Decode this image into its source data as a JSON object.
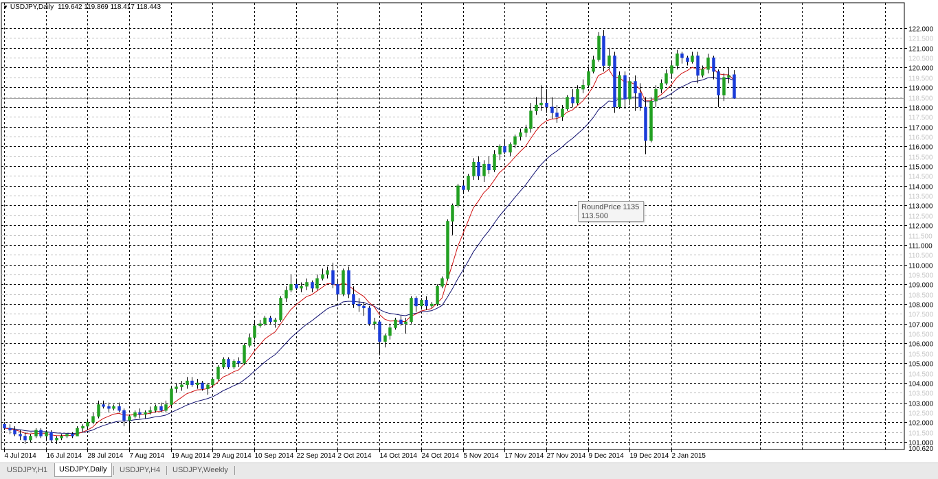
{
  "header": {
    "symbol_label": "USDJPY,Daily",
    "ohlc": "119.642 119.869 118.417 118.443"
  },
  "tooltip": {
    "line1": "RoundPrice 1135",
    "line2": "113.500"
  },
  "tabs": [
    {
      "label": "USDJPY,H1",
      "active": false
    },
    {
      "label": "USDJPY,Daily",
      "active": true
    },
    {
      "label": "USDJPY,H4",
      "active": false
    },
    {
      "label": "USDJPY,Weekly",
      "active": false
    }
  ],
  "colors": {
    "bull": "#22a022",
    "bear": "#1a3cd8",
    "ma_fast": "#d01010",
    "ma_slow": "#101070",
    "grid_major": "#000000",
    "grid_minor": "#b8b8b8"
  },
  "chart_data": {
    "type": "candlestick",
    "symbol": "USDJPY",
    "timeframe": "Daily",
    "y_range": [
      100.62,
      122.87
    ],
    "current_price": 118.443,
    "y_major_ticks": [
      "101.000",
      "102.000",
      "103.000",
      "104.000",
      "105.000",
      "106.000",
      "107.000",
      "108.000",
      "109.000",
      "110.000",
      "111.000",
      "112.000",
      "113.000",
      "114.000",
      "115.000",
      "116.000",
      "117.000",
      "118.000",
      "119.000",
      "120.000",
      "121.000",
      "122.000"
    ],
    "y_minor_ticks": [
      "101.500",
      "102.500",
      "103.500",
      "104.500",
      "105.500",
      "106.500",
      "107.500",
      "108.500",
      "109.500",
      "110.500",
      "111.500",
      "112.500",
      "113.500",
      "114.500",
      "115.500",
      "116.500",
      "117.500",
      "118.500",
      "119.500",
      "120.500",
      "121.500"
    ],
    "y_bottom_label": "100.620",
    "x_labels": [
      "4 Jul 2014",
      "16 Jul 2014",
      "28 Jul 2014",
      "7 Aug 2014",
      "19 Aug 2014",
      "29 Aug 2014",
      "10 Sep 2014",
      "22 Sep 2014",
      "2 Oct 2014",
      "14 Oct 2014",
      "24 Oct 2014",
      "5 Nov 2014",
      "17 Nov 2014",
      "27 Nov 2014",
      "9 Dec 2014",
      "19 Dec 2014",
      "2 Jan 2015"
    ],
    "series_ma": [
      "fast",
      "slow"
    ],
    "candles": [
      [
        101.9,
        102.0,
        101.6,
        101.7
      ],
      [
        101.7,
        101.9,
        101.4,
        101.6
      ],
      [
        101.6,
        101.8,
        101.3,
        101.4
      ],
      [
        101.4,
        101.6,
        101.1,
        101.3
      ],
      [
        101.3,
        101.5,
        100.9,
        101.1
      ],
      [
        101.1,
        101.4,
        101.0,
        101.3
      ],
      [
        101.3,
        101.7,
        101.2,
        101.6
      ],
      [
        101.6,
        101.7,
        101.2,
        101.3
      ],
      [
        101.3,
        101.6,
        101.1,
        101.5
      ],
      [
        101.5,
        101.6,
        101.0,
        101.1
      ],
      [
        101.1,
        101.3,
        100.9,
        101.2
      ],
      [
        101.2,
        101.4,
        101.1,
        101.3
      ],
      [
        101.3,
        101.4,
        101.2,
        101.4
      ],
      [
        101.4,
        101.5,
        101.2,
        101.3
      ],
      [
        101.3,
        101.8,
        101.3,
        101.7
      ],
      [
        101.7,
        101.9,
        101.5,
        101.8
      ],
      [
        101.8,
        102.1,
        101.6,
        102.0
      ],
      [
        102.0,
        102.5,
        101.9,
        102.3
      ],
      [
        102.3,
        103.1,
        102.2,
        102.9
      ],
      [
        102.9,
        103.1,
        102.7,
        102.8
      ],
      [
        102.8,
        103.0,
        102.5,
        102.7
      ],
      [
        102.7,
        102.9,
        102.6,
        102.8
      ],
      [
        102.8,
        103.0,
        102.5,
        102.6
      ],
      [
        102.6,
        102.7,
        101.8,
        102.1
      ],
      [
        102.1,
        102.4,
        101.5,
        102.3
      ],
      [
        102.3,
        102.6,
        102.2,
        102.5
      ],
      [
        102.5,
        102.7,
        102.2,
        102.4
      ],
      [
        102.4,
        102.6,
        102.2,
        102.5
      ],
      [
        102.5,
        102.8,
        102.4,
        102.6
      ],
      [
        102.6,
        102.9,
        102.5,
        102.8
      ],
      [
        102.8,
        103.0,
        102.5,
        102.6
      ],
      [
        102.6,
        103.1,
        102.5,
        102.9
      ],
      [
        102.9,
        103.8,
        102.8,
        103.7
      ],
      [
        103.7,
        104.0,
        103.5,
        103.8
      ],
      [
        103.8,
        104.1,
        103.6,
        103.9
      ],
      [
        103.9,
        104.3,
        103.7,
        104.1
      ],
      [
        104.1,
        104.3,
        103.8,
        103.9
      ],
      [
        103.9,
        104.2,
        103.7,
        104.0
      ],
      [
        104.0,
        104.1,
        103.6,
        103.7
      ],
      [
        103.7,
        104.0,
        103.4,
        103.9
      ],
      [
        103.9,
        104.3,
        103.8,
        104.2
      ],
      [
        104.2,
        104.9,
        104.1,
        104.8
      ],
      [
        104.8,
        105.3,
        104.7,
        105.2
      ],
      [
        105.2,
        105.3,
        104.7,
        104.8
      ],
      [
        104.8,
        105.2,
        104.7,
        105.1
      ],
      [
        105.1,
        105.3,
        104.8,
        105.0
      ],
      [
        105.0,
        106.0,
        104.9,
        105.9
      ],
      [
        105.9,
        106.5,
        105.8,
        106.3
      ],
      [
        106.3,
        107.1,
        106.2,
        106.9
      ],
      [
        106.9,
        107.2,
        106.8,
        107.0
      ],
      [
        107.0,
        107.4,
        106.9,
        107.3
      ],
      [
        107.3,
        107.4,
        107.0,
        107.1
      ],
      [
        107.1,
        107.3,
        106.8,
        107.2
      ],
      [
        107.2,
        108.4,
        107.1,
        108.3
      ],
      [
        108.3,
        108.9,
        108.1,
        108.7
      ],
      [
        108.7,
        109.5,
        108.6,
        109.0
      ],
      [
        109.0,
        109.3,
        108.7,
        108.8
      ],
      [
        108.8,
        109.1,
        108.6,
        108.9
      ],
      [
        108.9,
        109.3,
        108.7,
        109.1
      ],
      [
        109.1,
        109.2,
        108.6,
        108.8
      ],
      [
        108.8,
        109.5,
        108.7,
        109.3
      ],
      [
        109.3,
        109.8,
        109.2,
        109.5
      ],
      [
        109.5,
        109.9,
        109.3,
        109.7
      ],
      [
        109.7,
        110.1,
        108.8,
        109.0
      ],
      [
        109.0,
        109.2,
        108.2,
        108.5
      ],
      [
        108.5,
        109.8,
        108.4,
        109.7
      ],
      [
        109.7,
        109.9,
        108.3,
        108.5
      ],
      [
        108.5,
        108.9,
        107.8,
        108.0
      ],
      [
        108.0,
        108.3,
        107.6,
        107.9
      ],
      [
        107.9,
        108.1,
        107.4,
        107.8
      ],
      [
        107.8,
        107.9,
        106.9,
        107.0
      ],
      [
        107.0,
        107.3,
        106.7,
        107.1
      ],
      [
        107.1,
        107.2,
        105.4,
        106.1
      ],
      [
        106.1,
        106.5,
        105.8,
        106.4
      ],
      [
        106.4,
        107.0,
        106.2,
        106.8
      ],
      [
        106.8,
        107.3,
        106.7,
        107.2
      ],
      [
        107.2,
        107.4,
        106.9,
        107.0
      ],
      [
        107.0,
        107.3,
        106.5,
        107.1
      ],
      [
        107.1,
        108.4,
        107.0,
        108.3
      ],
      [
        108.3,
        108.4,
        107.6,
        107.9
      ],
      [
        107.9,
        108.3,
        107.8,
        108.2
      ],
      [
        108.2,
        108.4,
        107.7,
        107.9
      ],
      [
        107.9,
        108.1,
        107.8,
        108.0
      ],
      [
        108.0,
        109.0,
        107.9,
        108.9
      ],
      [
        108.9,
        109.4,
        108.8,
        109.3
      ],
      [
        109.3,
        112.3,
        109.2,
        112.2
      ],
      [
        112.2,
        113.1,
        111.5,
        113.0
      ],
      [
        113.0,
        114.1,
        112.9,
        114.0
      ],
      [
        114.0,
        114.3,
        113.6,
        113.8
      ],
      [
        113.8,
        114.6,
        113.7,
        114.5
      ],
      [
        114.5,
        115.4,
        114.3,
        115.2
      ],
      [
        115.2,
        115.5,
        114.3,
        114.5
      ],
      [
        114.5,
        115.3,
        114.2,
        115.1
      ],
      [
        115.1,
        115.5,
        114.6,
        114.8
      ],
      [
        114.8,
        115.8,
        114.7,
        115.6
      ],
      [
        115.6,
        116.1,
        115.3,
        116.0
      ],
      [
        116.0,
        116.3,
        115.6,
        115.7
      ],
      [
        115.7,
        116.2,
        115.5,
        116.1
      ],
      [
        116.1,
        116.6,
        115.9,
        116.5
      ],
      [
        116.5,
        116.9,
        116.3,
        116.7
      ],
      [
        116.7,
        117.1,
        116.5,
        116.9
      ],
      [
        116.9,
        118.2,
        116.7,
        117.8
      ],
      [
        117.8,
        118.5,
        117.6,
        118.1
      ],
      [
        118.1,
        119.1,
        117.8,
        118.2
      ],
      [
        118.2,
        118.8,
        117.7,
        118.0
      ],
      [
        118.0,
        118.5,
        117.4,
        117.7
      ],
      [
        117.7,
        118.1,
        117.2,
        117.5
      ],
      [
        117.5,
        118.1,
        117.3,
        117.9
      ],
      [
        117.9,
        118.6,
        117.8,
        118.5
      ],
      [
        118.5,
        118.9,
        118.0,
        118.2
      ],
      [
        118.2,
        119.1,
        118.1,
        118.9
      ],
      [
        118.9,
        119.4,
        118.7,
        119.1
      ],
      [
        119.1,
        120.0,
        119.0,
        119.8
      ],
      [
        119.8,
        120.6,
        119.7,
        120.4
      ],
      [
        120.4,
        121.8,
        120.3,
        121.6
      ],
      [
        121.6,
        121.9,
        119.8,
        120.1
      ],
      [
        120.1,
        121.0,
        119.9,
        120.6
      ],
      [
        120.6,
        120.8,
        117.7,
        118.0
      ],
      [
        118.0,
        119.8,
        117.9,
        119.6
      ],
      [
        119.6,
        119.8,
        117.9,
        118.4
      ],
      [
        118.4,
        119.5,
        118.1,
        119.3
      ],
      [
        119.3,
        119.6,
        117.8,
        118.7
      ],
      [
        118.7,
        119.2,
        117.8,
        118.0
      ],
      [
        118.0,
        118.5,
        115.6,
        116.3
      ],
      [
        116.3,
        118.5,
        116.2,
        118.3
      ],
      [
        118.3,
        119.1,
        118.0,
        118.9
      ],
      [
        118.9,
        119.4,
        118.7,
        119.2
      ],
      [
        119.2,
        119.9,
        119.1,
        119.7
      ],
      [
        119.7,
        120.3,
        119.5,
        120.1
      ],
      [
        120.1,
        120.9,
        119.9,
        120.7
      ],
      [
        120.7,
        120.8,
        120.2,
        120.5
      ],
      [
        120.5,
        120.6,
        120.1,
        120.3
      ],
      [
        120.3,
        120.8,
        120.2,
        120.6
      ],
      [
        120.6,
        120.8,
        119.2,
        119.6
      ],
      [
        119.6,
        120.1,
        119.5,
        119.9
      ],
      [
        119.9,
        120.7,
        119.7,
        120.5
      ],
      [
        120.5,
        120.6,
        119.4,
        119.8
      ],
      [
        119.8,
        119.9,
        118.0,
        118.6
      ],
      [
        118.6,
        119.7,
        118.3,
        119.5
      ],
      [
        119.5,
        120.0,
        119.2,
        119.6
      ],
      [
        119.642,
        119.869,
        118.417,
        118.443
      ]
    ]
  }
}
